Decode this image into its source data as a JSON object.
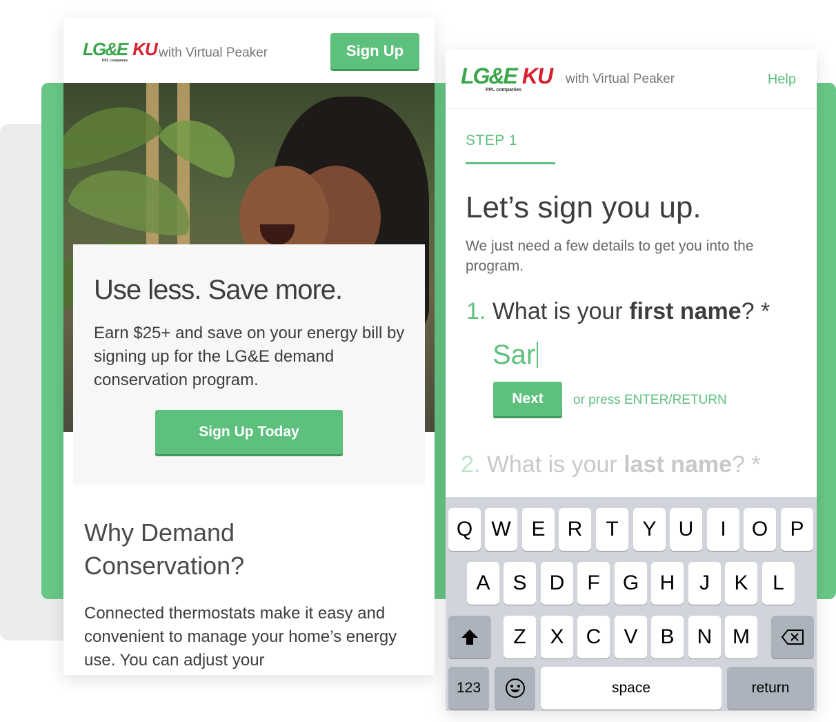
{
  "left_panel": {
    "header": {
      "logo_lge": "LG&E",
      "logo_ku": "KU",
      "logo_sub": "PPL companies",
      "with_vp": "with Virtual Peaker",
      "signup_label": "Sign Up"
    },
    "promo": {
      "title": "Use less. Save more.",
      "text": "Earn $25+ and save on your energy bill by signing up for the LG&E demand conservation program.",
      "button_label": "Sign Up Today"
    },
    "why": {
      "title": "Why Demand Conservation?",
      "text": "Connected thermostats make it easy and convenient to manage your home’s energy use. You can adjust your"
    }
  },
  "right_panel": {
    "header": {
      "logo_lge": "LG&E",
      "logo_ku": "KU",
      "logo_sub": "PPL companies",
      "with_vp": "with Virtual Peaker",
      "help_label": "Help"
    },
    "step_label": "STEP 1",
    "title": "Let’s sign you up.",
    "subtitle": "We just need a few details to get you into the program.",
    "question1": {
      "number": "1.",
      "prefix": "What is your ",
      "bold": "first name",
      "suffix": "? *",
      "answer_value": "Sar"
    },
    "next_label": "Next",
    "press_hint": "or press ENTER/RETURN",
    "question2": {
      "number": "2.",
      "prefix": "What is your ",
      "bold": "last name",
      "suffix": "? *"
    }
  },
  "keyboard": {
    "row1": [
      "Q",
      "W",
      "E",
      "R",
      "T",
      "Y",
      "U",
      "I",
      "O",
      "P"
    ],
    "row2": [
      "A",
      "S",
      "D",
      "F",
      "G",
      "H",
      "J",
      "K",
      "L"
    ],
    "row3": [
      "Z",
      "X",
      "C",
      "V",
      "B",
      "N",
      "M"
    ],
    "numbers_label": "123",
    "space_label": "space",
    "return_label": "return",
    "shift_icon": "shift-icon",
    "backspace_icon": "backspace-icon",
    "emoji_icon": "emoji-icon"
  },
  "colors": {
    "brand_green": "#5ec07d",
    "background_green": "#68c786",
    "lge_green": "#3aa54a",
    "ku_red": "#d7202b"
  }
}
